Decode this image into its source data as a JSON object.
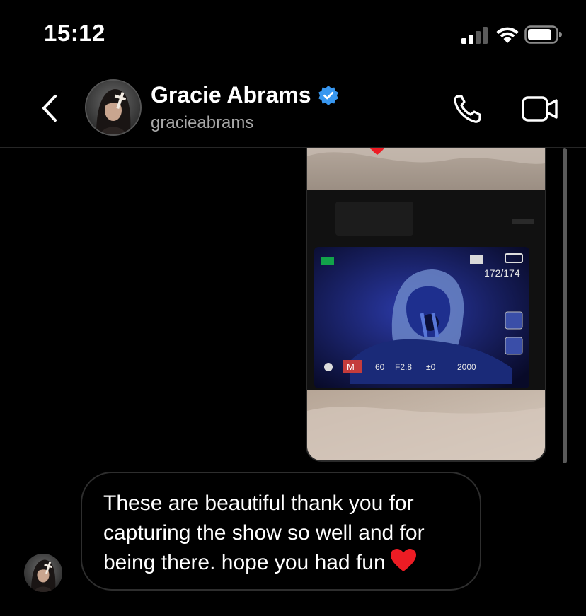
{
  "status_bar": {
    "time": "15:12"
  },
  "header": {
    "contact_name": "Gracie Abrams",
    "username": "gracieabrams",
    "verified": true
  },
  "thread": {
    "photo_message": {
      "reaction": "heart",
      "camera_screen": {
        "image_count": "172/174",
        "mode": "M",
        "shutter": "60",
        "aperture": "F2.8",
        "exposure_comp": "±0",
        "iso": "2000"
      }
    },
    "received_message": {
      "text": "These are beautiful thank you for capturing the show so well and for being there. hope you had fun"
    }
  },
  "colors": {
    "background": "#000000",
    "verified_blue": "#3897f0",
    "heart_red": "#ed1c24",
    "bubble_border": "#2e2e2e",
    "secondary_text": "#a8a8a8"
  }
}
